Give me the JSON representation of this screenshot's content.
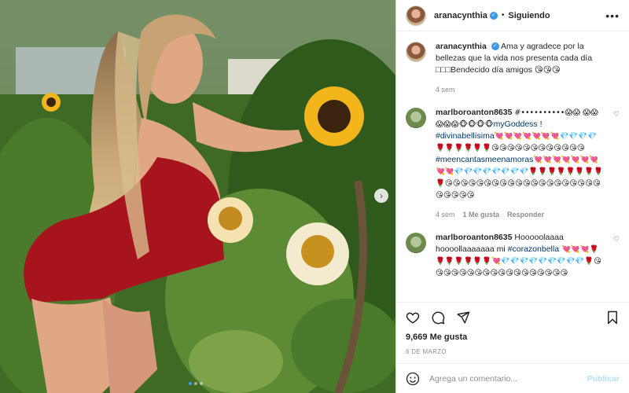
{
  "header": {
    "username": "aranacynthia",
    "separator": "•",
    "follow_label": "Siguiendo",
    "more_label": "•••"
  },
  "caption": {
    "username": "aranacynthia",
    "text": "Ama y agradece por la bellezas que la vida nos presenta cada día □□□Bendecido día amigos 😘😘😘",
    "time": "4 sem"
  },
  "comments": [
    {
      "username": "marlboroanton8635",
      "intro": "#••••••••••😱😱",
      "line1": "😱😱😱😱😱🐵🐵🐵🐵",
      "tag1": "myGoddess !",
      "tag2": "#divinabellísima",
      "emojis1": "💘💘💘💘💘💘💘💎💎💎💎🌹🌹🌹🌹🌹🌹😘😘😘😘😘😘😘😘😘😘😘😘",
      "tag3": "#meencantasmeenamoras",
      "emojis2": "💘💘💘💘💘💘💘💘💘💎💎💎💎💎💎💎💎🌹🌹🌹🌹🌹🌹🌹🌹🌹😘😘😘😘😘😘😘😘😘😘😘😘😘😘😘😘😘😘😘😘😘😘😘😘😘",
      "time": "4 sem",
      "likes": "1 Me gusta",
      "reply": "Responder"
    },
    {
      "username": "marlboroanton8635",
      "text": "Hooooolaaaa hoooollaaaaaaa mi",
      "tag": "#corazonbella",
      "emojis": "💘💘💘🌹🌹🌹🌹🌹🌹🌹💘💎💎💎💎💎💎💎💎💎🌹😘😘😘😘😘😘😘😘😘😘😘😘😘😘😘😘😘😘"
    }
  ],
  "actions": {
    "likes": "9,669 Me gusta",
    "date": "6 DE MARZO"
  },
  "add_comment": {
    "placeholder": "Agrega un comentario...",
    "publish_label": "Publicar"
  },
  "colors": {
    "link": "#00376b",
    "verified": "#3897f0",
    "publish_disabled": "#b2dffc"
  }
}
